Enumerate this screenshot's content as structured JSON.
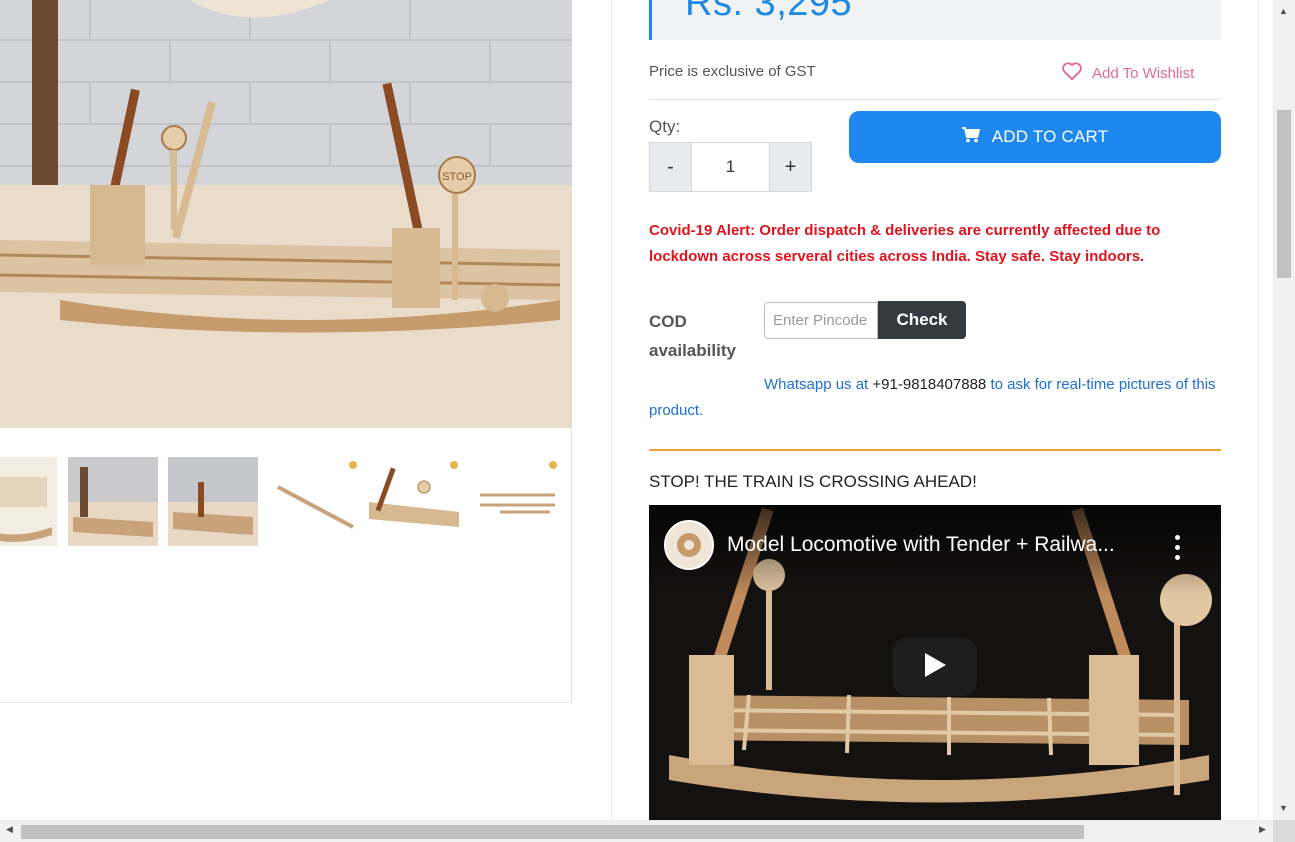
{
  "product": {
    "price": "Rs. 3,295",
    "gst_note": "Price is exclusive of GST",
    "wishlist_label": "Add To Wishlist"
  },
  "quantity": {
    "label": "Qty:",
    "value": "1",
    "minus": "-",
    "plus": "+"
  },
  "cart": {
    "button_label": "ADD TO CART"
  },
  "alert": {
    "text": "Covid-19 Alert: Order dispatch & deliveries are currently affected due to lockdown across serveral cities across India. Stay safe. Stay indoors."
  },
  "cod": {
    "label": "COD availability",
    "placeholder": "Enter Pincode",
    "check_label": "Check"
  },
  "whatsapp": {
    "prefix": "Whatsapp us at ",
    "phone": "+91-9818407888",
    "suffix": " to ask for real-time pictures of this product."
  },
  "section": {
    "title": "STOP! THE TRAIN IS CROSSING AHEAD!"
  },
  "video": {
    "title": "Model Locomotive with Tender + Railwa..."
  },
  "main_photo": {
    "sign_text": "STOP"
  },
  "colors": {
    "accent_blue": "#1e88f0",
    "price_blue": "#1e88e5",
    "alert_red": "#e0141e",
    "wishlist_pink": "#e26b8f",
    "divider_orange": "#f0a133",
    "check_dark": "#343a40"
  },
  "icons": [
    "heart-icon",
    "cart-icon",
    "play-icon",
    "more-vert-icon"
  ]
}
